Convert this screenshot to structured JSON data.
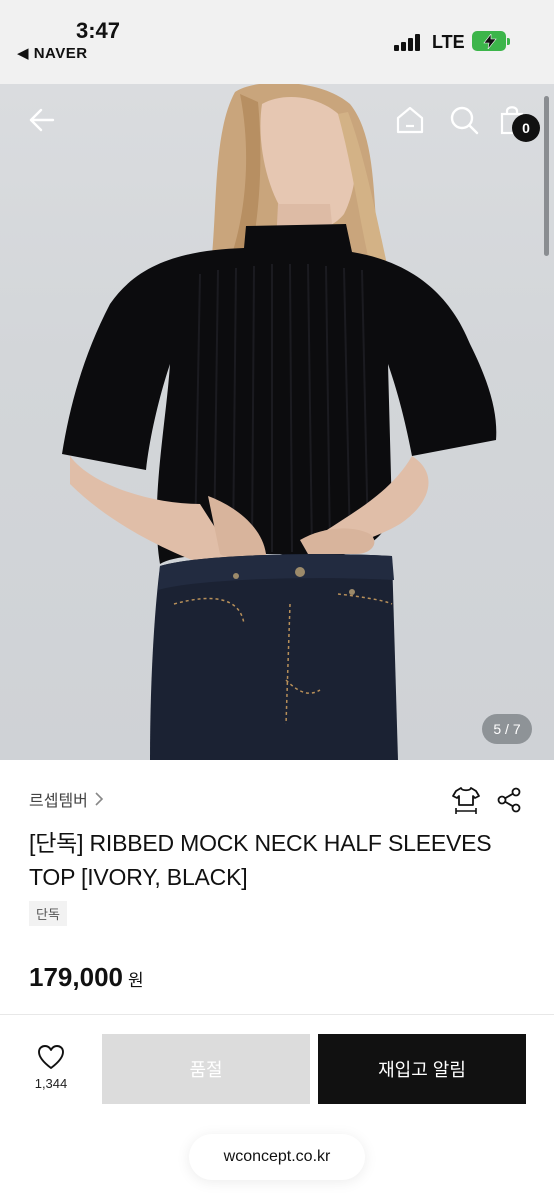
{
  "status_bar": {
    "time": "3:47",
    "back_app": "◀ NAVER",
    "carrier": "LTE",
    "battery_charging": true
  },
  "header": {
    "back_icon": "arrow-left-icon",
    "home_icon": "home-icon",
    "search_icon": "search-icon",
    "cart_icon": "shopping-bag-icon",
    "cart_count": "0"
  },
  "gallery": {
    "counter": "5 / 7"
  },
  "product": {
    "brand": "르셉템버",
    "title": "[단독] RIBBED MOCK NECK HALF SLEEVES TOP [IVORY, BLACK]",
    "tag": "단독",
    "price": "179,000",
    "currency": "원"
  },
  "actions": {
    "like_count": "1,344",
    "soldout_label": "품절",
    "restock_label": "재입고 알림"
  },
  "browser": {
    "url": "wconcept.co.kr"
  },
  "colors": {
    "accent": "#111111",
    "soldout_bg": "#dcdcdc",
    "battery": "#3cb54a"
  }
}
